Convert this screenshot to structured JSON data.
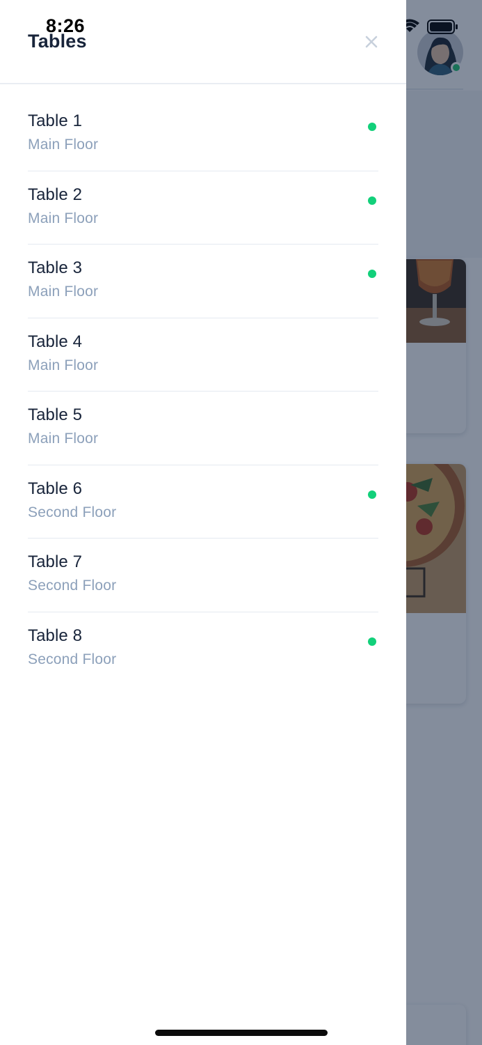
{
  "status_bar": {
    "time": "8:26"
  },
  "drawer": {
    "title": "Tables",
    "close_icon": "close-icon",
    "tables": [
      {
        "name": "Table 1",
        "floor": "Main Floor",
        "active": true
      },
      {
        "name": "Table 2",
        "floor": "Main Floor",
        "active": true
      },
      {
        "name": "Table 3",
        "floor": "Main Floor",
        "active": true
      },
      {
        "name": "Table 4",
        "floor": "Main Floor",
        "active": false
      },
      {
        "name": "Table 5",
        "floor": "Main Floor",
        "active": false
      },
      {
        "name": "Table 6",
        "floor": "Second Floor",
        "active": true
      },
      {
        "name": "Table 7",
        "floor": "Second Floor",
        "active": false
      },
      {
        "name": "Table 8",
        "floor": "Second Floor",
        "active": true
      }
    ]
  },
  "colors": {
    "active_dot": "#12d07a",
    "title_text": "#18243a",
    "subtitle_text": "#8ca0ba",
    "overlay": "#142442"
  }
}
